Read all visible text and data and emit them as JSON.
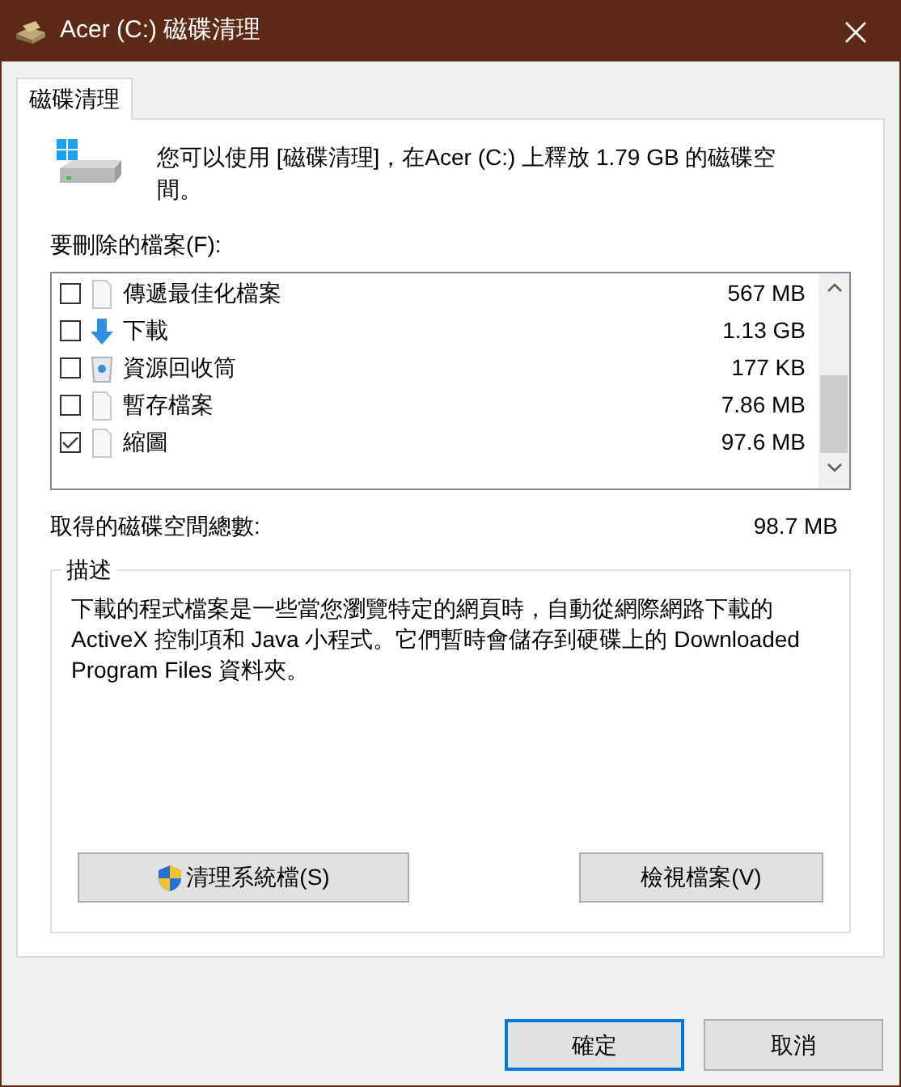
{
  "window": {
    "title": "Acer  (C:) 磁碟清理"
  },
  "tabs": [
    {
      "label": "磁碟清理",
      "selected": true
    }
  ],
  "intro": "您可以使用 [磁碟清理]，在Acer (C:) 上釋放 1.79 GB 的磁碟空間。",
  "files_label": "要刪除的檔案(F):",
  "files": [
    {
      "kind": "file",
      "name": "傳遞最佳化檔案",
      "size": "567 MB",
      "checked": false
    },
    {
      "kind": "download",
      "name": "下載",
      "size": "1.13 GB",
      "checked": false
    },
    {
      "kind": "recycle",
      "name": "資源回收筒",
      "size": "177 KB",
      "checked": false
    },
    {
      "kind": "file",
      "name": "暫存檔案",
      "size": "7.86 MB",
      "checked": false
    },
    {
      "kind": "file",
      "name": "縮圖",
      "size": "97.6 MB",
      "checked": true
    }
  ],
  "total": {
    "label": "取得的磁碟空間總數:",
    "value": "98.7 MB"
  },
  "description": {
    "title": "描述",
    "text": "下載的程式檔案是一些當您瀏覽特定的網頁時，自動從網際網路下載的 ActiveX 控制項和 Java 小程式。它們暫時會儲存到硬碟上的 Downloaded Program Files 資料夾。"
  },
  "panel_buttons": [
    {
      "label": "清理系統檔(S)",
      "shield": true
    },
    {
      "label": "檢視檔案(V)",
      "shield": false
    }
  ],
  "buttons": [
    {
      "label": "確定",
      "default": true
    },
    {
      "label": "取消",
      "default": false
    }
  ]
}
